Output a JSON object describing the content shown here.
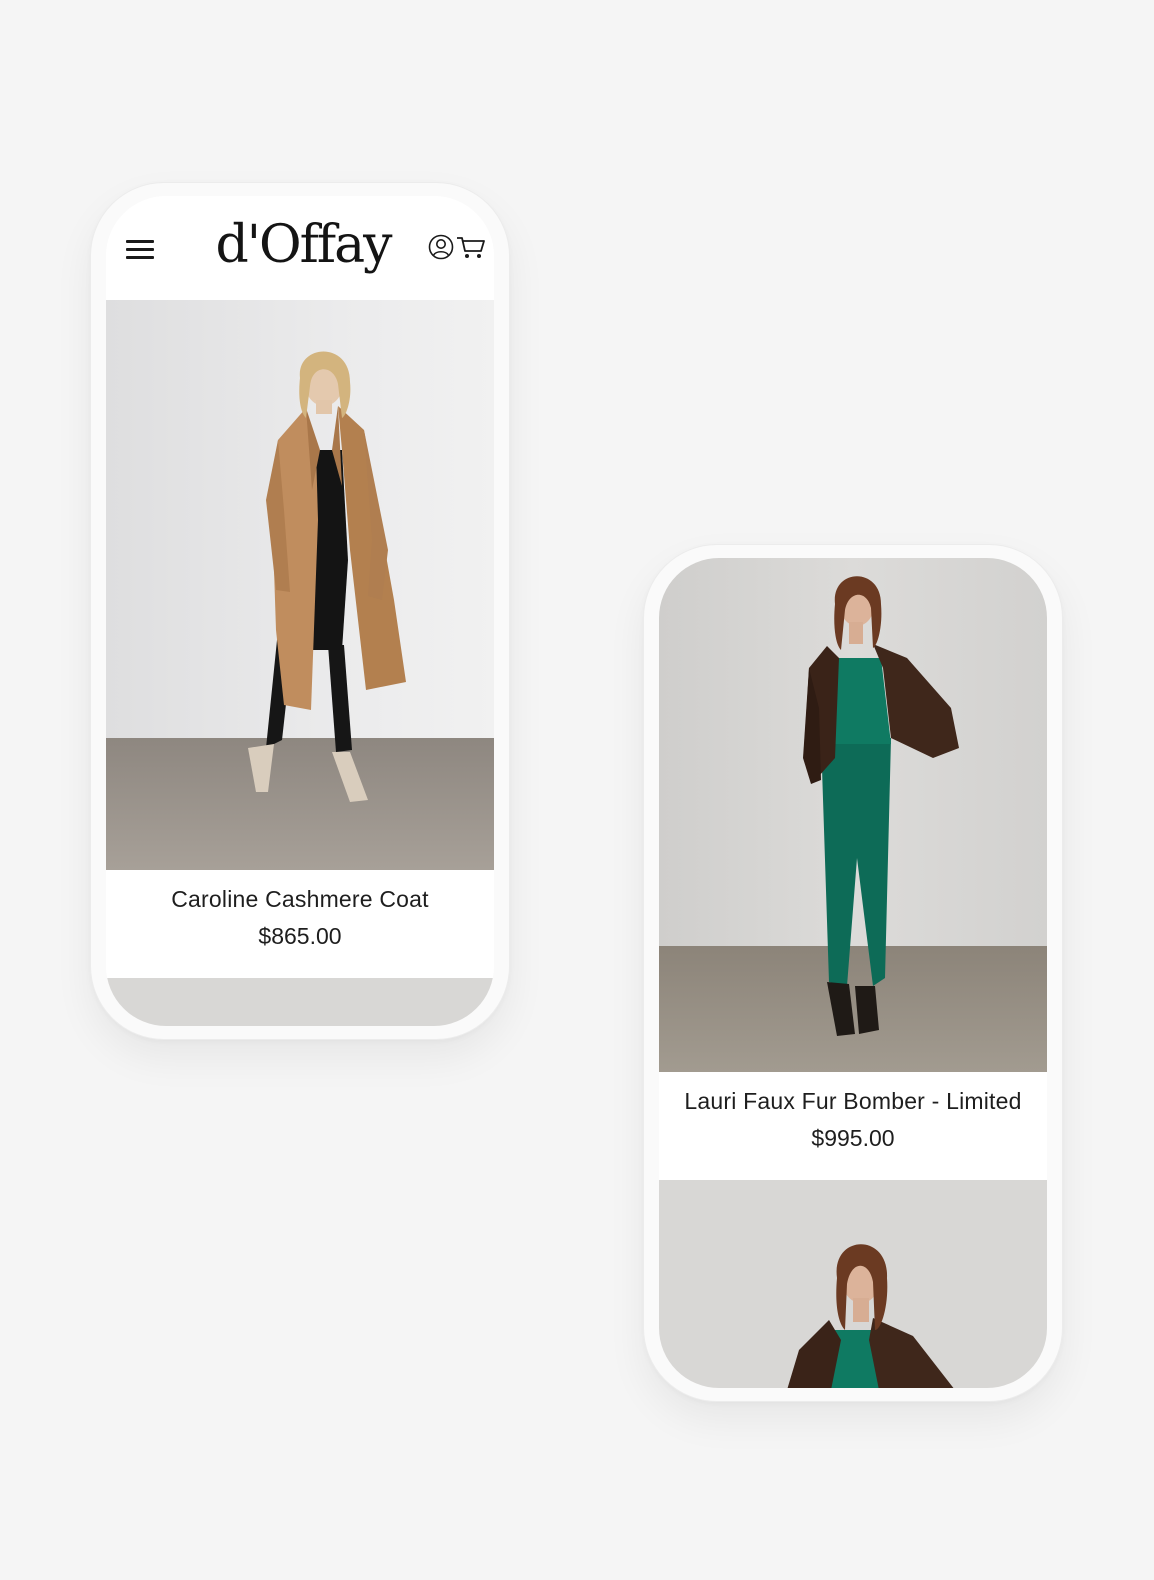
{
  "brand": {
    "logo_text": "d'Offay"
  },
  "header": {
    "menu_icon": "hamburger-menu-icon",
    "account_icon": "user-account-icon",
    "cart_icon": "shopping-cart-icon"
  },
  "products": [
    {
      "name": "Caroline Cashmere Coat",
      "price": "$865.00"
    },
    {
      "name": "Lauri Faux Fur Bomber - Limited",
      "price": "$995.00"
    }
  ],
  "colors": {
    "background": "#f5f5f5",
    "text": "#1e1e1e",
    "camel_coat": "#c08d5e",
    "emerald_jumpsuit": "#0d6b57",
    "brown_fur": "#3a2318"
  }
}
